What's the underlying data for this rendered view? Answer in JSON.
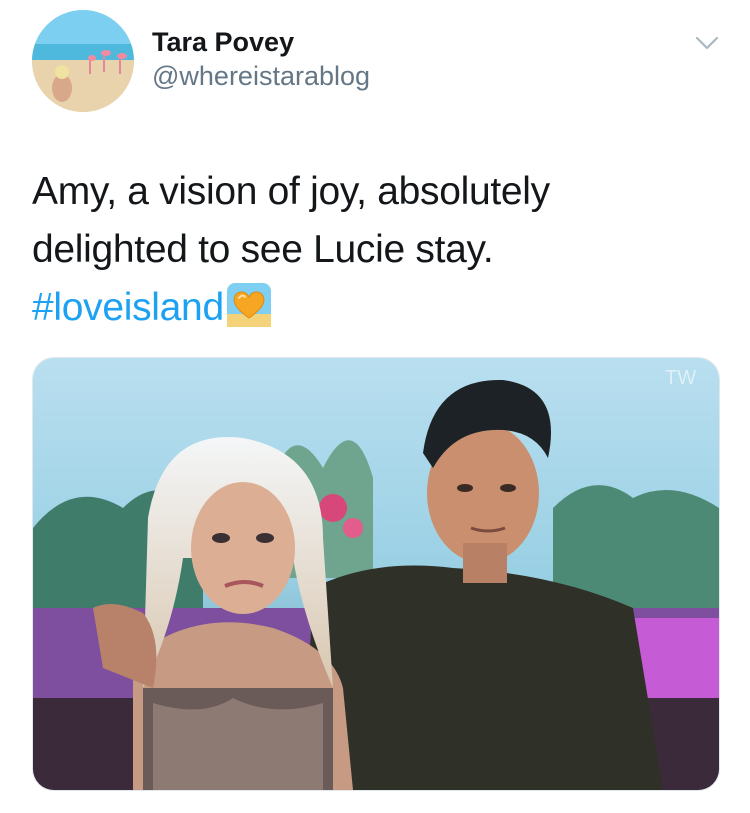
{
  "tweet": {
    "author": {
      "display_name": "Tara Povey",
      "handle": "@whereistarablog",
      "avatar_icon": "beach-flamingo-avatar"
    },
    "menu_icon": "chevron-down-icon",
    "text_line_1": "Amy, a vision of joy, absolutely",
    "text_line_2": "delighted to see Lucie stay.",
    "hashtag": "#loveisland",
    "emoji": "yellow-heart-island-emoji",
    "media": {
      "description_icon": "tv-screen-photo",
      "watermark": "TW"
    },
    "colors": {
      "text": "#14171a",
      "secondary": "#657786",
      "link": "#1da1f2"
    }
  }
}
